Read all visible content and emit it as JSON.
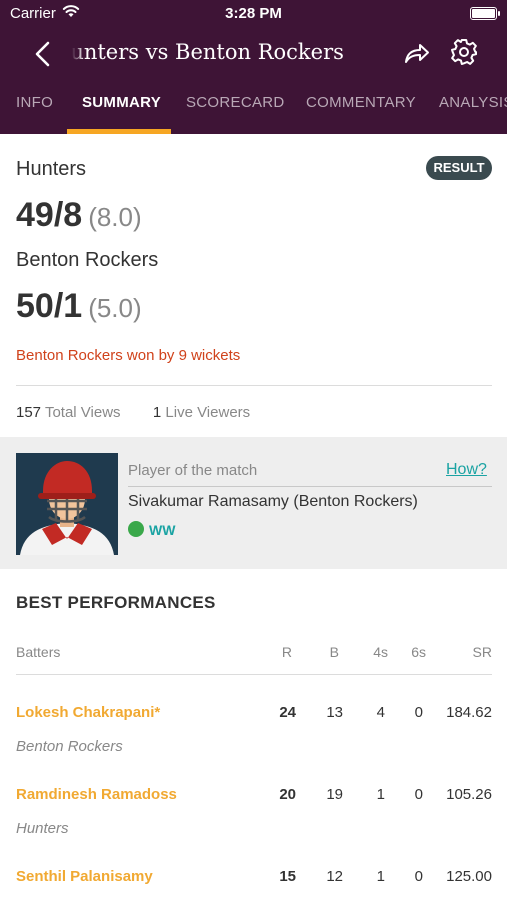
{
  "status_bar": {
    "carrier": "Carrier",
    "time": "3:28 PM"
  },
  "nav": {
    "title": "Hunters vs Benton Rockers"
  },
  "tabs": [
    {
      "label": "INFO"
    },
    {
      "label": "SUMMARY"
    },
    {
      "label": "SCORECARD"
    },
    {
      "label": "COMMENTARY"
    },
    {
      "label": "ANALYSIS"
    }
  ],
  "summary": {
    "badge": "RESULT",
    "team1": {
      "name": "Hunters",
      "score": "49/8",
      "overs": "(8.0)"
    },
    "team2": {
      "name": "Benton Rockers",
      "score": "50/1",
      "overs": "(5.0)"
    },
    "result_text": "Benton Rockers won by 9 wickets",
    "total_views_count": "157",
    "total_views_label": "Total Views",
    "live_viewers_count": "1",
    "live_viewers_label": "Live Viewers"
  },
  "player_of_match": {
    "label": "Player of the match",
    "how_link": "How?",
    "player": "Sivakumar Ramasamy (Benton Rockers)",
    "role": "WW"
  },
  "best_performances": {
    "title": "BEST PERFORMANCES",
    "headers": {
      "batters": "Batters",
      "r": "R",
      "b": "B",
      "fours": "4s",
      "sixes": "6s",
      "sr": "SR"
    },
    "rows": [
      {
        "name": "Lokesh Chakrapani*",
        "team": "Benton Rockers",
        "r": "24",
        "b": "13",
        "fours": "4",
        "sixes": "0",
        "sr": "184.62"
      },
      {
        "name": "Ramdinesh Ramadoss",
        "team": "Hunters",
        "r": "20",
        "b": "19",
        "fours": "1",
        "sixes": "0",
        "sr": "105.26"
      },
      {
        "name": "Senthil Palanisamy",
        "team": "",
        "r": "15",
        "b": "12",
        "fours": "1",
        "sixes": "0",
        "sr": "125.00"
      }
    ]
  },
  "colors": {
    "header_bg": "#3e1436",
    "accent": "#f6a623",
    "result_red": "#d0421b",
    "link_teal": "#1aa3a3",
    "batter_gold": "#f1a932"
  }
}
